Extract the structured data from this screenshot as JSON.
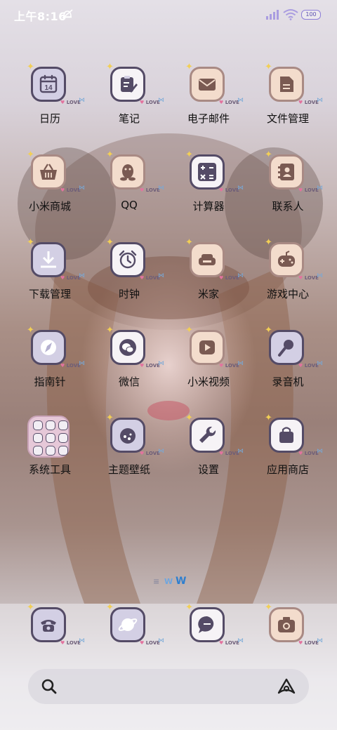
{
  "status_bar": {
    "time": "上午8:16",
    "battery": "100"
  },
  "apps": [
    {
      "label": "日历",
      "icon": "calendar-icon",
      "day": "14"
    },
    {
      "label": "笔记",
      "icon": "notes-icon"
    },
    {
      "label": "电子邮件",
      "icon": "mail-icon"
    },
    {
      "label": "文件管理",
      "icon": "file-manager-icon"
    },
    {
      "label": "小米商城",
      "icon": "shopping-basket-icon"
    },
    {
      "label": "QQ",
      "icon": "qq-penguin-icon"
    },
    {
      "label": "计算器",
      "icon": "calculator-icon"
    },
    {
      "label": "联系人",
      "icon": "contacts-icon"
    },
    {
      "label": "下载管理",
      "icon": "download-icon"
    },
    {
      "label": "时钟",
      "icon": "alarm-clock-icon"
    },
    {
      "label": "米家",
      "icon": "sofa-icon"
    },
    {
      "label": "游戏中心",
      "icon": "gamepad-icon"
    },
    {
      "label": "指南针",
      "icon": "compass-icon"
    },
    {
      "label": "微信",
      "icon": "wechat-icon"
    },
    {
      "label": "小米视频",
      "icon": "video-play-icon"
    },
    {
      "label": "录音机",
      "icon": "microphone-icon"
    },
    {
      "label": "系统工具",
      "icon": "folder-icon"
    },
    {
      "label": "主题壁纸",
      "icon": "theme-icon"
    },
    {
      "label": "设置",
      "icon": "wrench-icon"
    },
    {
      "label": "应用商店",
      "icon": "shopping-bag-icon"
    }
  ],
  "badge": {
    "text": "LOVE",
    "heart": "♥"
  },
  "dock": [
    {
      "icon": "phone-icon"
    },
    {
      "icon": "browser-planet-icon"
    },
    {
      "icon": "messages-icon"
    },
    {
      "icon": "camera-icon"
    }
  ],
  "page_indicator": [
    "≡",
    "W",
    "W"
  ],
  "search_bar": {
    "left_icon": "search-icon",
    "right_icon": "assistant-icon"
  },
  "colors": {
    "icon_outline": "#544b66",
    "lavender": "#d3cfe4",
    "peach": "#f3dccc",
    "sparkle": "#f2cf55"
  }
}
